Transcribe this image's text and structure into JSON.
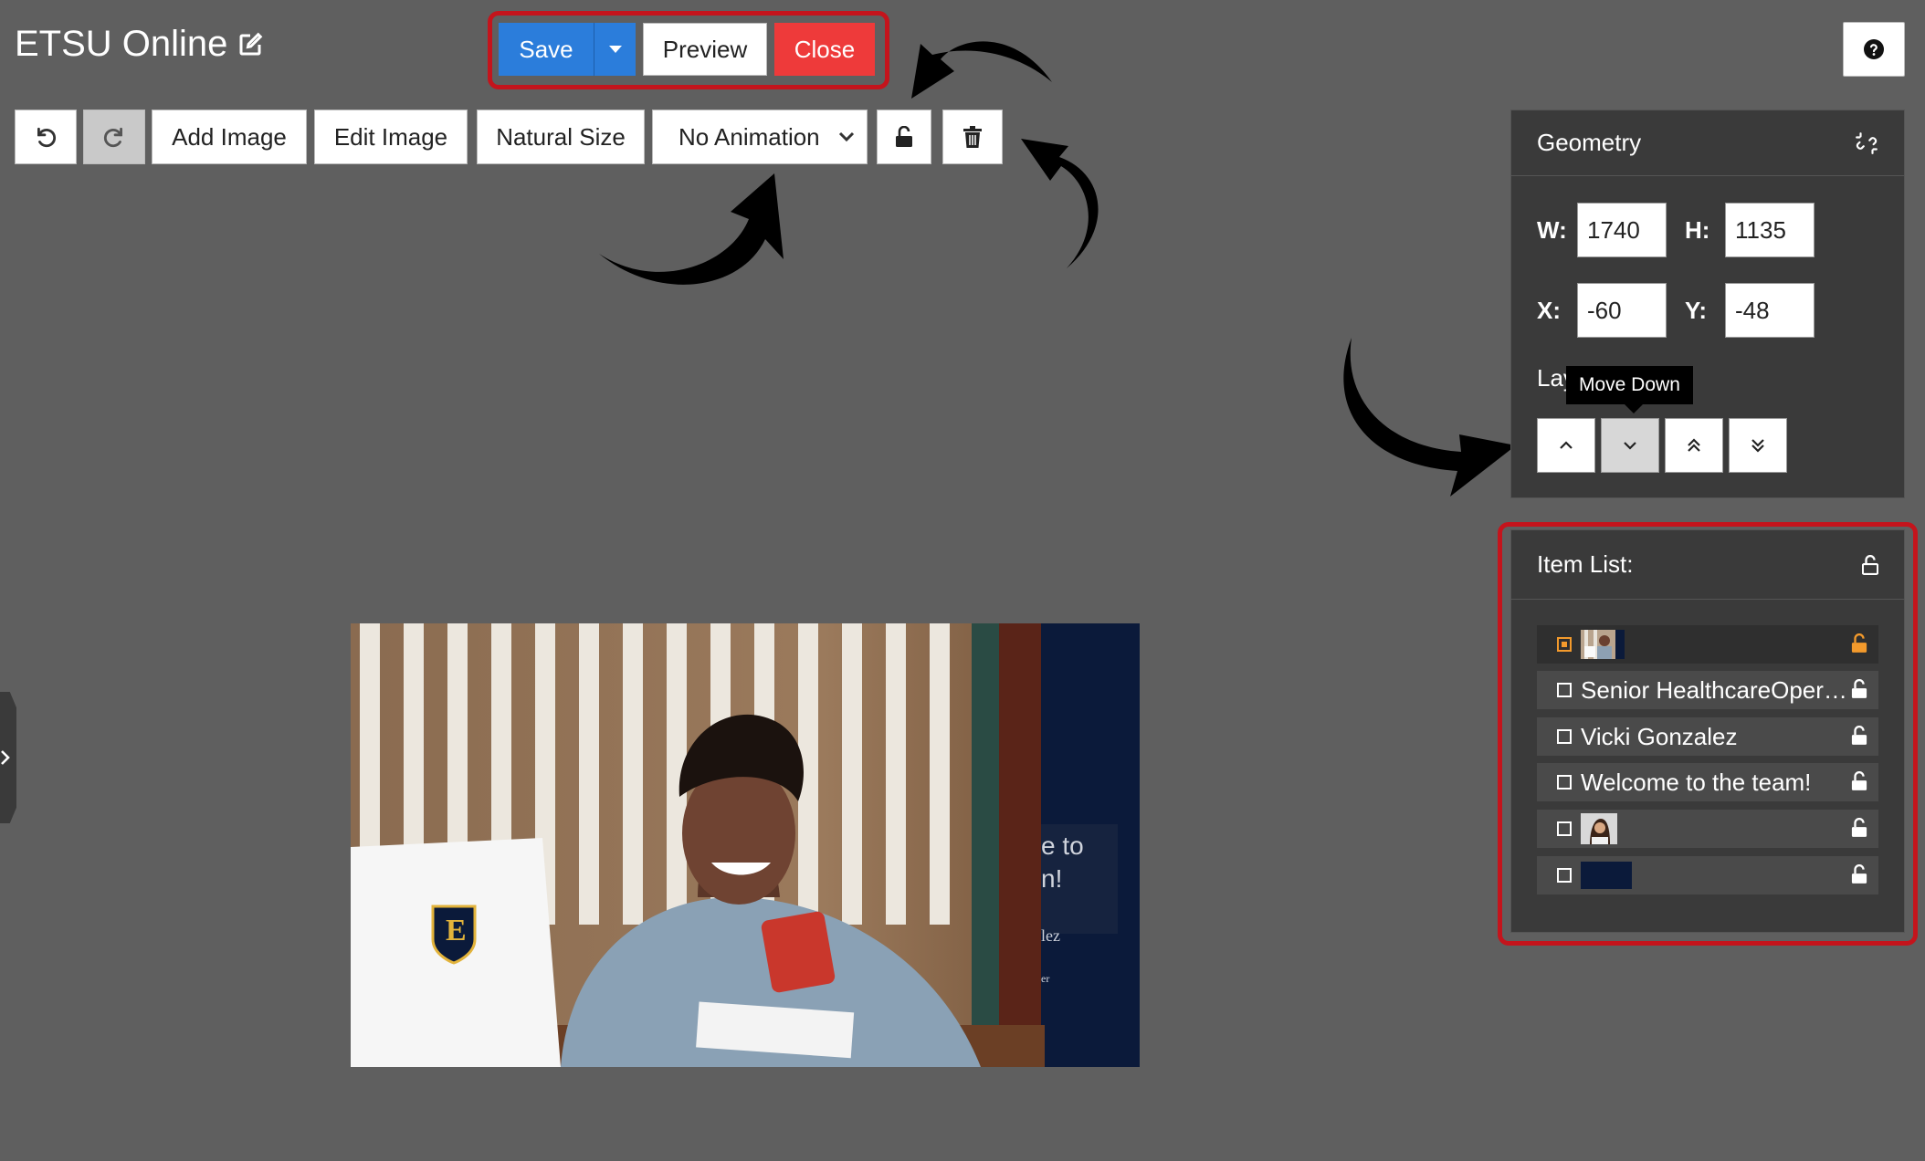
{
  "header": {
    "title": "ETSU Online"
  },
  "actions": {
    "save": "Save",
    "preview": "Preview",
    "close": "Close"
  },
  "toolbar": {
    "add_image": "Add Image",
    "edit_image": "Edit Image",
    "natural_size": "Natural Size",
    "animation": "No Animation"
  },
  "geometry": {
    "title": "Geometry",
    "w_label": "W:",
    "w_value": "1740",
    "h_label": "H:",
    "h_value": "1135",
    "x_label": "X:",
    "x_value": "-60",
    "y_label": "Y:",
    "y_value": "-48",
    "layers_label": "Layers",
    "tooltip": "Move Down"
  },
  "item_list": {
    "title": "Item List:",
    "items": [
      {
        "label": "",
        "type": "image"
      },
      {
        "label": "Senior HealthcareOperations",
        "type": "text"
      },
      {
        "label": "Vicki Gonzalez",
        "type": "text"
      },
      {
        "label": "Welcome to the team!",
        "type": "text"
      },
      {
        "label": "",
        "type": "image"
      },
      {
        "label": "",
        "type": "shape"
      }
    ]
  },
  "canvas": {
    "overlay_line1": "e to",
    "overlay_line2": "n!",
    "overlay_line3": "lez",
    "overlay_line4": "er",
    "logo_letter": "E"
  },
  "colors": {
    "save": "#2b7ddb",
    "close": "#ee3a3a",
    "highlight": "#c4141c",
    "panel": "#3a3a3a",
    "lock_selected": "#f39a2c",
    "navy": "#0b1a3a"
  }
}
